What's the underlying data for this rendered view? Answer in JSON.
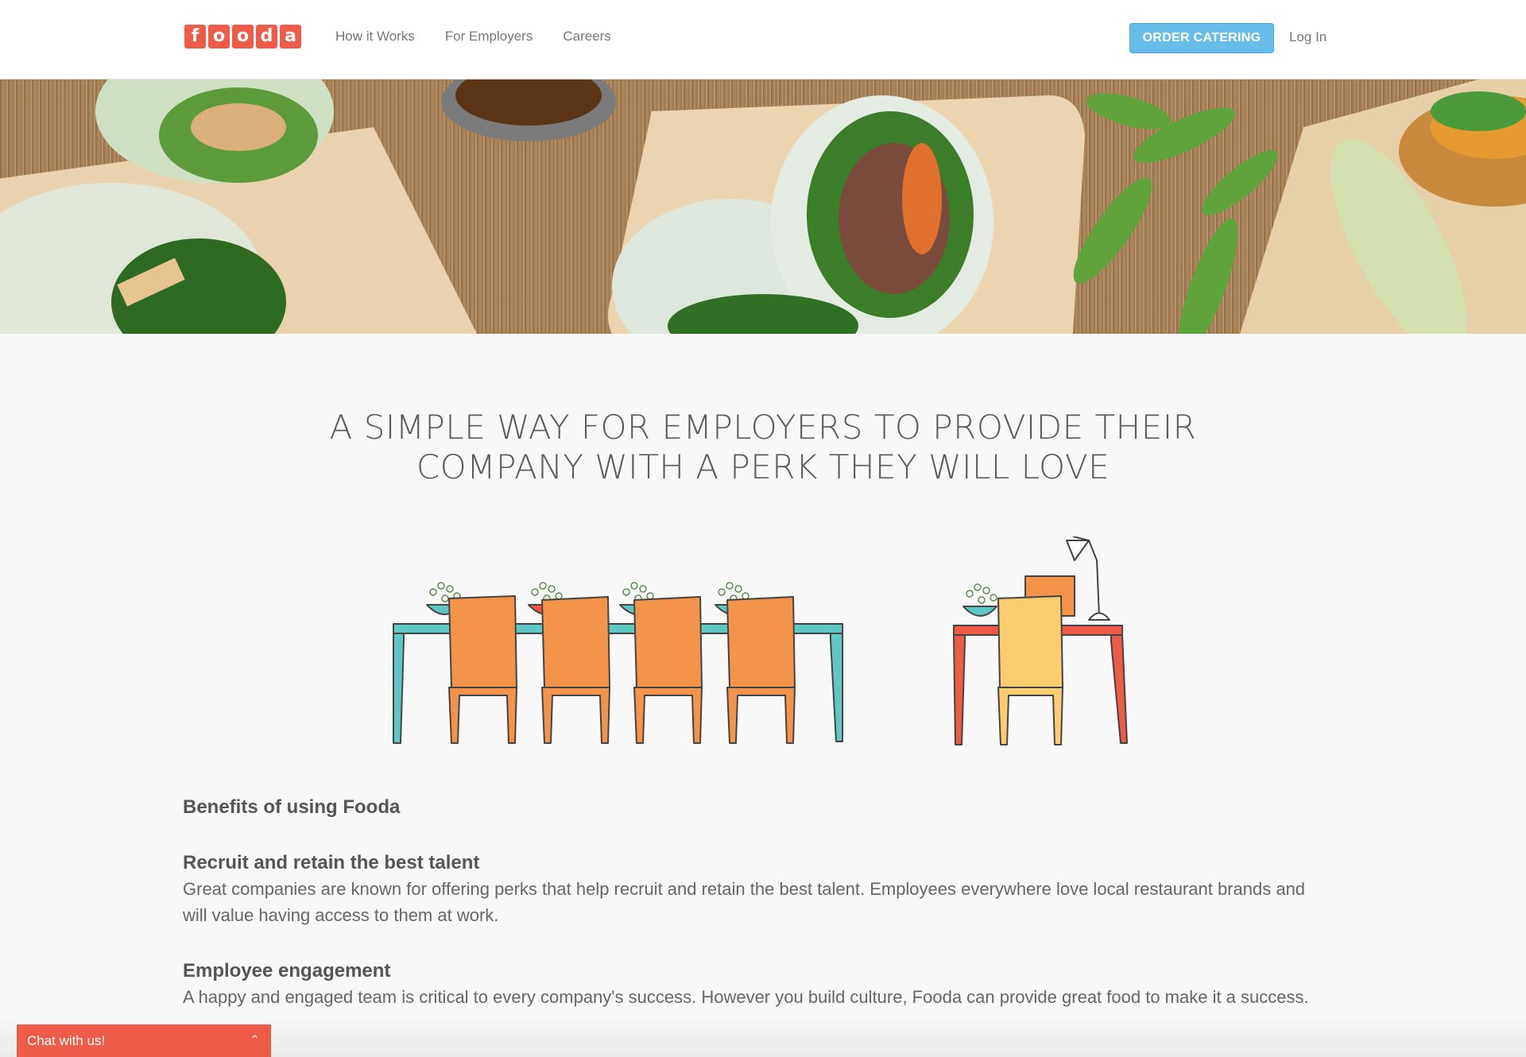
{
  "header": {
    "logo_letters": [
      "f",
      "o",
      "o",
      "d",
      "a"
    ],
    "nav": [
      "How it Works",
      "For Employers",
      "Careers"
    ],
    "order_button": "ORDER CATERING",
    "login": "Log In"
  },
  "headline": {
    "line1": "A SIMPLE WAY FOR EMPLOYERS TO PROVIDE THEIR",
    "line2": "COMPANY WITH A PERK THEY WILL LOVE"
  },
  "benefits": {
    "title": "Benefits of using Fooda",
    "items": [
      {
        "title": "Recruit and retain the best talent",
        "text": "Great companies are known for offering perks that help recruit and retain the best talent. Employees everywhere love local restaurant brands and will value having access to them at work."
      },
      {
        "title": "Employee engagement",
        "text": "A happy and engaged team is critical to every company's success. However you build culture, Fooda can provide great food to make it a success."
      }
    ]
  },
  "chat": {
    "label": "Chat with us!",
    "caret": "⌃"
  },
  "colors": {
    "brand_red": "#ee5b46",
    "button_blue": "#66bdea",
    "teal": "#5fc8c4",
    "orange": "#f4944a",
    "yellow": "#fbcd6e"
  }
}
